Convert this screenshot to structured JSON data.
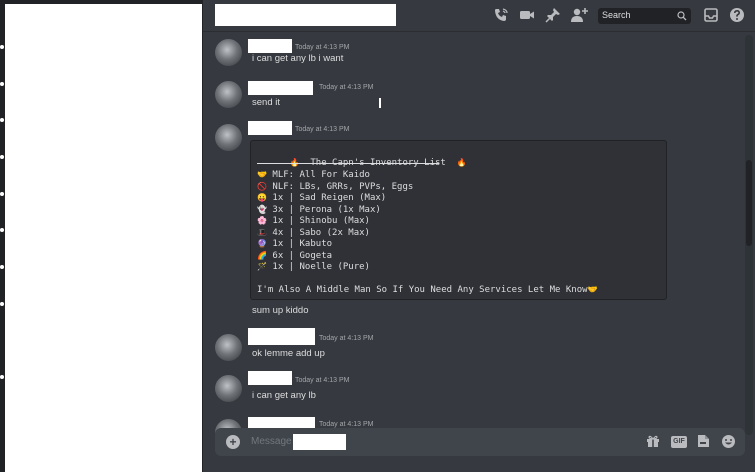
{
  "header": {
    "search_placeholder": "Search",
    "icons": [
      "call-icon",
      "video-icon",
      "pin-icon",
      "add-member-icon",
      "search-icon",
      "inbox-icon",
      "help-icon"
    ]
  },
  "messages": [
    {
      "timestamp": "Today at 4:13 PM",
      "text": "i can get any lb i want"
    },
    {
      "timestamp": "Today at 4:13 PM",
      "text": "send it"
    },
    {
      "timestamp": "Today at 4:13 PM",
      "text": "sum up kiddo"
    },
    {
      "timestamp": "Today at 4:13 PM",
      "text": "ok lemme add up"
    },
    {
      "timestamp": "Today at 4:13 PM",
      "text": "i can get any lb"
    },
    {
      "timestamp": "Today at 4:13 PM",
      "text": ""
    }
  ],
  "embed": {
    "title_emoji": "🔥",
    "title": "The Capn's Inventory List",
    "lines": [
      {
        "emoji": "🤝",
        "text": "MLF: All For Kaido"
      },
      {
        "emoji": "🚫",
        "text": "NLF: LBs, GRRs, PVPs, Eggs"
      },
      {
        "emoji": "😛",
        "text": "1x | Sad Reigen (Max)"
      },
      {
        "emoji": "👻",
        "text": "3x | Perona (1x Max)"
      },
      {
        "emoji": "🌸",
        "text": "1x | Shinobu (Max)"
      },
      {
        "emoji": "🎩",
        "text": "4x | Sabo (2x Max)"
      },
      {
        "emoji": "🔮",
        "text": "1x | Kabuto"
      },
      {
        "emoji": "🌈",
        "text": "6x | Gogeta"
      },
      {
        "emoji": "🪄",
        "text": "1x | Noelle (Pure)"
      }
    ],
    "footer": "I'm Also A Middle Man So If You Need Any Services Let Me Know",
    "footer_emoji": "🤝"
  },
  "composer": {
    "placeholder": "Message",
    "icons": [
      "gift-icon",
      "gif-icon",
      "sticker-icon",
      "emoji-icon"
    ],
    "gif_label": "GIF"
  }
}
